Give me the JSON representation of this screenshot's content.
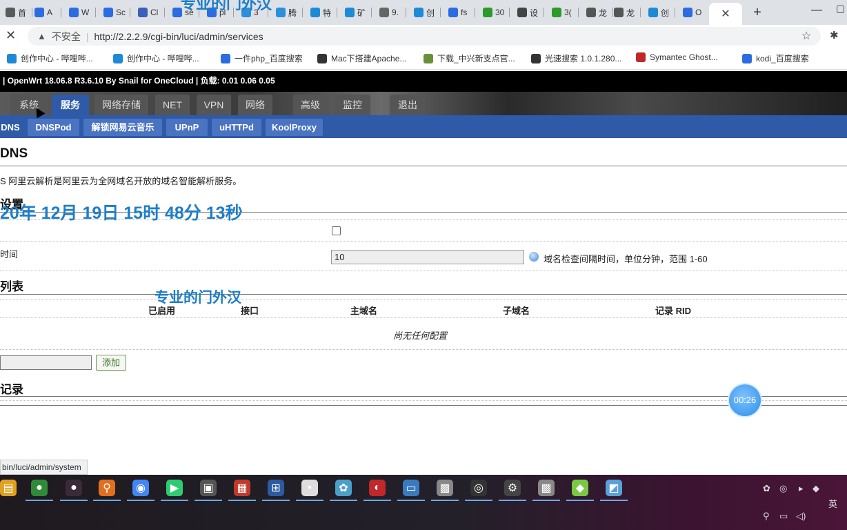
{
  "browser": {
    "tabs": [
      {
        "label": "首",
        "color": "#5a5a5a"
      },
      {
        "label": "A",
        "color": "#2b6de0"
      },
      {
        "label": "W",
        "color": "#2b6de0"
      },
      {
        "label": "Sc",
        "color": "#2b6de0"
      },
      {
        "label": "Cl",
        "color": "#3d5fb8"
      },
      {
        "label": "se",
        "color": "#2b6de0"
      },
      {
        "label": "pl",
        "color": "#2b6de0"
      },
      {
        "label": "3",
        "color": "#2b8fdb"
      },
      {
        "label": "腾",
        "color": "#2b8fdb"
      },
      {
        "label": "特",
        "color": "#1e8ad6"
      },
      {
        "label": "矿",
        "color": "#1e8ad6"
      },
      {
        "label": "9.",
        "color": "#666666"
      },
      {
        "label": "创",
        "color": "#1e8ad6"
      },
      {
        "label": "fs",
        "color": "#2b6de0"
      },
      {
        "label": "30",
        "color": "#2a9a2a"
      },
      {
        "label": "设",
        "color": "#444444"
      },
      {
        "label": "3(",
        "color": "#2a9a2a"
      },
      {
        "label": "龙",
        "color": "#555555"
      },
      {
        "label": "龙",
        "color": "#555555"
      },
      {
        "label": "创",
        "color": "#1e8ad6"
      },
      {
        "label": "O",
        "color": "#2b6de0"
      }
    ],
    "active_tab_close": "✕",
    "new_tab": "+",
    "minimize": "—",
    "maximize": "▢",
    "insecure_label": "不安全",
    "url": "http://2.2.2.9/cgi-bin/luci/admin/services",
    "stop_icon": "✕",
    "star_icon": "☆",
    "ext_icon": "✱"
  },
  "bookmarks": [
    {
      "label": "创作中心 - 哔哩哔...",
      "color": "#1e8ad6"
    },
    {
      "label": "创作中心 - 哔哩哔...",
      "color": "#1e8ad6"
    },
    {
      "label": "一件php_百度搜索",
      "color": "#2b6de0"
    },
    {
      "label": "Mac下搭建Apache...",
      "color": "#333333"
    },
    {
      "label": "下载_中兴新支点官...",
      "color": "#6a8f3a"
    },
    {
      "label": "光速搜索 1.0.1.280...",
      "color": "#333333"
    },
    {
      "label": "Symantec Ghost...",
      "color": "#c0282a"
    },
    {
      "label": "kodi_百度搜索",
      "color": "#2b6de0"
    }
  ],
  "router": {
    "header": "| OpenWrt 18.06.8 R3.6.10 By Snail for OneCloud | 负载: 0.01 0.06 0.05",
    "menu": [
      "系统",
      "服务",
      "网络存储",
      "NET",
      "VPN",
      "网络",
      "高级",
      "监控",
      "退出"
    ],
    "submenu": [
      "DNS",
      "DNSPod",
      "解锁网易云音乐",
      "UPnP",
      "uHTTPd",
      "KoolProxy"
    ],
    "page_title": "DNS",
    "description": "S 阿里云解析是阿里云为全网域名开放的域名智能解析服务。",
    "section_settings": "设置",
    "field_interval_label": "时间",
    "interval_value": "10",
    "interval_help": "域名检查间隔时间，单位分钟，范围 1-60",
    "section_list": "列表",
    "table_headers": [
      "已启用",
      "接口",
      "主域名",
      "子域名",
      "记录 RID"
    ],
    "table_empty": "尚无任何配置",
    "add_button": "添加",
    "section_records": "记录",
    "status_link": "bin/luci/admin/system"
  },
  "overlay": {
    "watermark_top": "专业的门外汉",
    "timestamp": "20年 12月 19日 15时 48分 13秒",
    "watermark_mid": "专业的门外汉",
    "timer": "00:26"
  },
  "taskbar": {
    "ime": "英",
    "icons": [
      {
        "color": "#e0a020",
        "glyph": "▤"
      },
      {
        "color": "#2f8a3a",
        "glyph": "●"
      },
      {
        "color": "#3a2a3a",
        "glyph": "●"
      },
      {
        "color": "#e07020",
        "glyph": "⚲"
      },
      {
        "color": "#4285f4",
        "glyph": "◉"
      },
      {
        "color": "#2ecc71",
        "glyph": "▶"
      },
      {
        "color": "#555555",
        "glyph": "▣"
      },
      {
        "color": "#c0392b",
        "glyph": "▦"
      },
      {
        "color": "#2c5aa0",
        "glyph": "⊞"
      },
      {
        "color": "#dddddd",
        "glyph": "▪"
      },
      {
        "color": "#4aa0c8",
        "glyph": "✿"
      },
      {
        "color": "#c0282a",
        "glyph": "◐"
      },
      {
        "color": "#3a7abf",
        "glyph": "▭"
      },
      {
        "color": "#888888",
        "glyph": "▩"
      },
      {
        "color": "#333333",
        "glyph": "◎"
      },
      {
        "color": "#444444",
        "glyph": "⚙"
      },
      {
        "color": "#888888",
        "glyph": "▩"
      },
      {
        "color": "#7ac943",
        "glyph": "◆"
      },
      {
        "color": "#5aa0d8",
        "glyph": "◩"
      }
    ]
  }
}
